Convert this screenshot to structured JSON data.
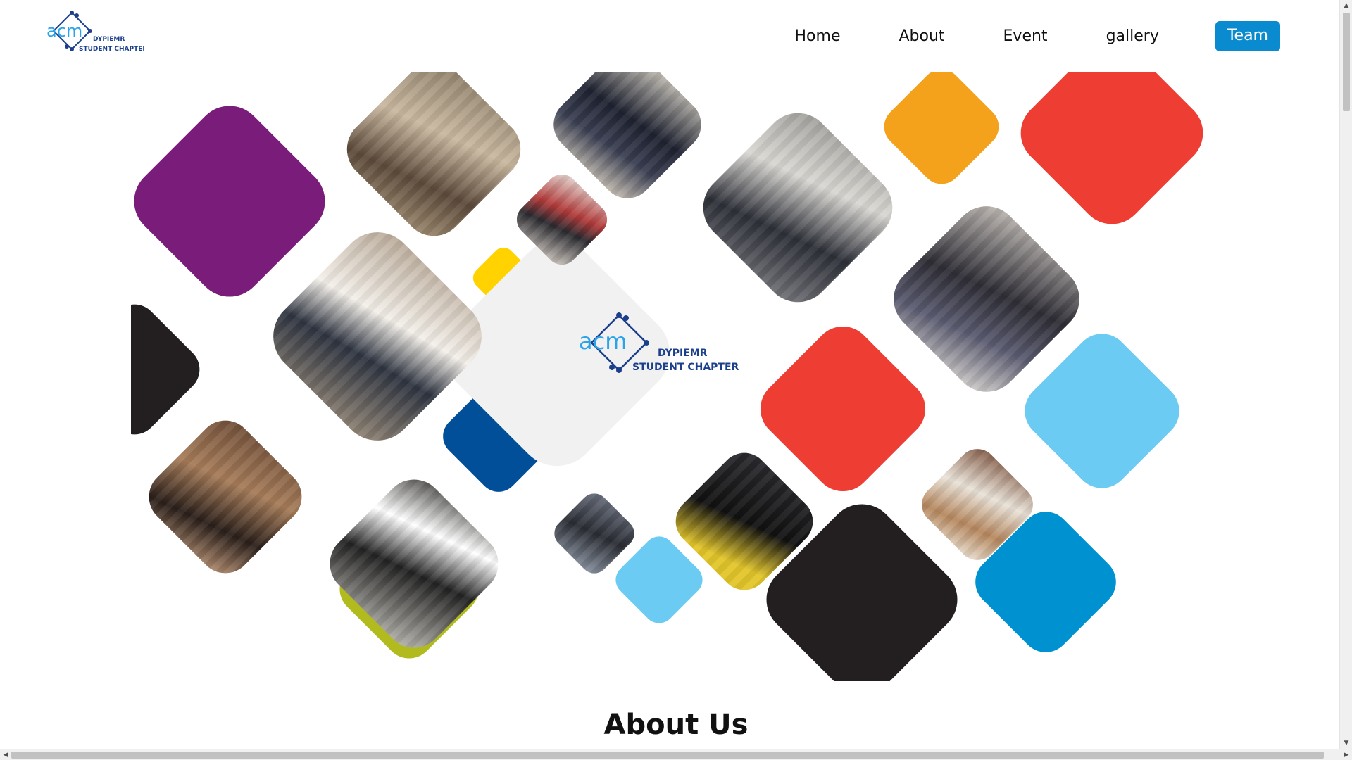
{
  "brand": {
    "logo_text": "acm",
    "logo_line1": "DYPIEMR",
    "logo_line2": "STUDENT CHAPTER",
    "accent": "#1a8fd8",
    "navy": "#1c3f8c"
  },
  "nav": {
    "items": [
      {
        "label": "Home"
      },
      {
        "label": "About"
      },
      {
        "label": "Event"
      },
      {
        "label": "gallery"
      }
    ],
    "cta": {
      "label": "Team",
      "color": "#0a8bcf"
    }
  },
  "hero": {
    "center_logo_text": "acm",
    "center_line1": "DYPIEMR",
    "center_line2": "STUDENT CHAPTER",
    "palette": {
      "purple": "#7a1c7a",
      "orange": "#f4a11c",
      "red": "#ee3d33",
      "yellow": "#ffd200",
      "black": "#231f20",
      "navy": "#004f98",
      "sky": "#6ccbf3",
      "blue": "#0092d0",
      "olive": "#b2bb1e",
      "light": "#f1f1f1"
    }
  },
  "about": {
    "title": "About Us"
  },
  "icons": [
    "acm-logo-icon",
    "scroll-up-icon",
    "scroll-down-icon",
    "scroll-left-icon",
    "scroll-right-icon"
  ]
}
